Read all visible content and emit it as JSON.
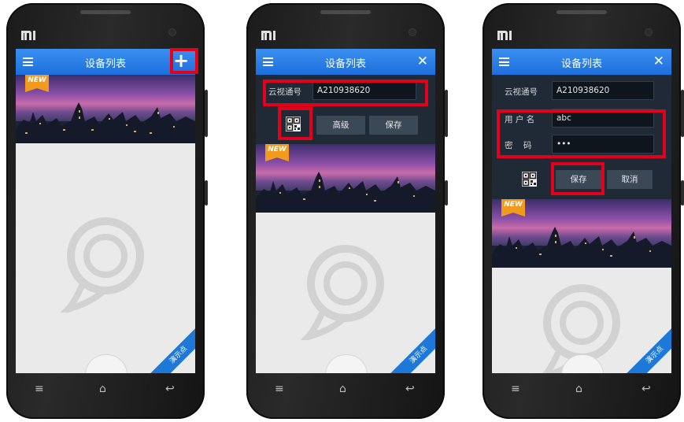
{
  "screens": [
    {
      "title": "设备列表",
      "banner_tag": "NEW",
      "demo_label": "演示点"
    },
    {
      "title": "设备列表",
      "cloud_id_label": "云视通号",
      "cloud_id_value": "A210938620",
      "advanced_button": "高级",
      "save_button": "保存",
      "banner_tag": "NEW",
      "demo_label": "演示点"
    },
    {
      "title": "设备列表",
      "cloud_id_label": "云视通号",
      "cloud_id_value": "A210938620",
      "username_label": "用 户 名",
      "username_value": "abc",
      "password_label": "密    码",
      "password_value": "•••",
      "save_button": "保存",
      "cancel_button": "取消",
      "banner_tag": "NEW",
      "demo_label": "演示点"
    }
  ],
  "device_brand": "mi",
  "softkeys": [
    "≡",
    "⌂",
    "↩"
  ],
  "colors": {
    "titlebar": "#2a7fe6",
    "highlight": "#e3001b",
    "form_bg": "#1f2a36"
  }
}
